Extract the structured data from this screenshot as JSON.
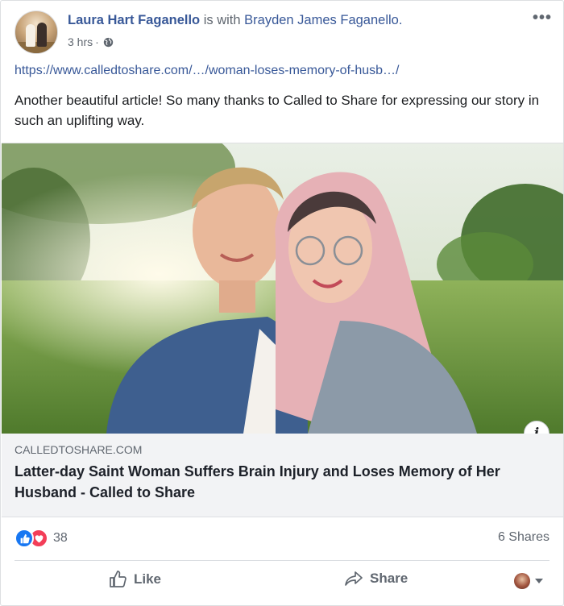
{
  "post": {
    "author": "Laura Hart Faganello",
    "with_text": " is with ",
    "tagged": "Brayden James Faganello.",
    "time": "3 hrs",
    "time_separator": "·",
    "privacy_icon": "globe-icon",
    "more_icon": "more-options-icon",
    "more_glyph": "•••",
    "link": "https://www.calledtoshare.com/…/woman-loses-memory-of-husb…/",
    "text": "Another beautiful article! So many thanks to Called to Share for expressing our story in such an uplifting way."
  },
  "attachment": {
    "info_glyph": "i",
    "domain": "CALLEDTOSHARE.COM",
    "headline": "Latter-day Saint Woman Suffers Brain Injury and Loses Memory of Her Husband - Called to Share"
  },
  "stats": {
    "reaction_icons": [
      "like-reaction-icon",
      "love-reaction-icon"
    ],
    "reaction_count": "38",
    "shares": "6 Shares"
  },
  "actions": {
    "like_label": "Like",
    "share_label": "Share"
  },
  "colors": {
    "link_blue": "#385898",
    "like_blue": "#1877f2",
    "love_red": "#f33e58",
    "caption_bg": "#f2f3f5"
  }
}
